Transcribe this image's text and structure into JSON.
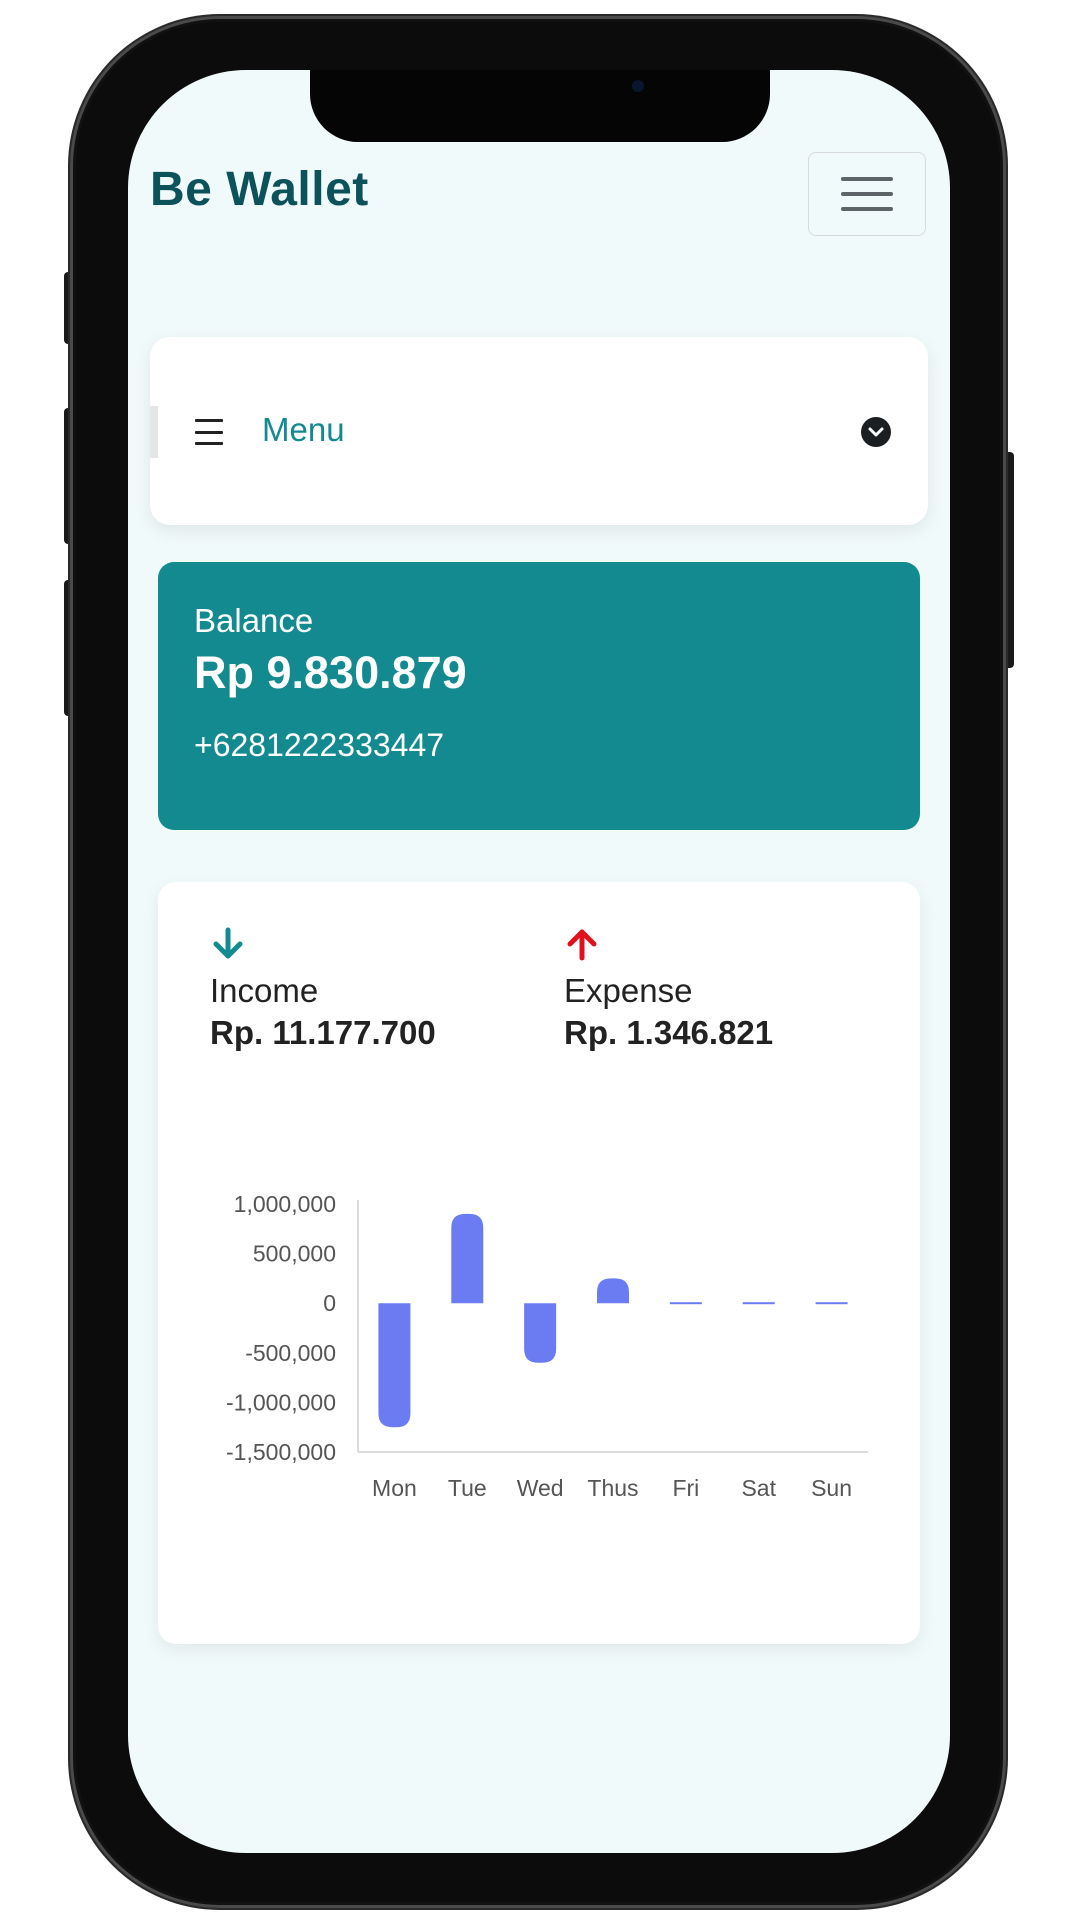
{
  "header": {
    "brand": "Be Wallet"
  },
  "menu": {
    "label": "Menu"
  },
  "balance": {
    "label": "Balance",
    "amount": "Rp 9.830.879",
    "phone": "+6281222333447"
  },
  "summary": {
    "income_label": "Income",
    "income_value": "Rp. 11.177.700",
    "expense_label": "Expense",
    "expense_value": "Rp. 1.346.821"
  },
  "icons": {
    "income": "arrow-down-icon",
    "expense": "arrow-up-icon",
    "menu": "list-icon",
    "dropdown": "chevron-down-circle-icon",
    "nav_toggle": "hamburger-icon"
  },
  "colors": {
    "brand": "#0b525b",
    "accent": "#128a8f",
    "income_arrow": "#128a8f",
    "expense_arrow": "#e0101c",
    "bar": "#6b7cf2",
    "background": "#f1fafb"
  },
  "chart_data": {
    "type": "bar",
    "categories": [
      "Mon",
      "Tue",
      "Wed",
      "Thus",
      "Fri",
      "Sat",
      "Sun"
    ],
    "values": [
      -1250000,
      900000,
      -600000,
      250000,
      0,
      0,
      0
    ],
    "ylim": [
      -1500000,
      1000000
    ],
    "yticks": [
      "1,000,000",
      "500,000",
      "0",
      "-500,000",
      "-1,000,000",
      "-1,500,000"
    ],
    "ytick_values": [
      1000000,
      500000,
      0,
      -500000,
      -1000000,
      -1500000
    ],
    "grid": false,
    "legend": "none"
  }
}
